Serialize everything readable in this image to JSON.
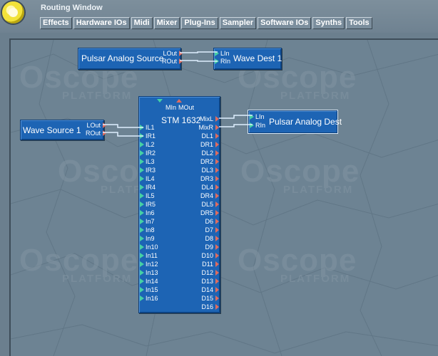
{
  "window": {
    "title": "Routing Window"
  },
  "menu": [
    "Effects",
    "Hardware IOs",
    "Midi",
    "Mixer",
    "Plug-Ins",
    "Sampler",
    "Software IOs",
    "Synths",
    "Tools"
  ],
  "watermark": {
    "logo": "Oscope",
    "sub": "PLATFORM"
  },
  "modules": {
    "pulsar_analog_source": {
      "name": "Pulsar Analog Source",
      "outputs": [
        "LOut",
        "ROut"
      ]
    },
    "wave_dest_1": {
      "name": "Wave Dest 1",
      "inputs": [
        "LIn",
        "RIn"
      ]
    },
    "wave_source_1": {
      "name": "Wave Source 1",
      "outputs": [
        "LOut",
        "ROut"
      ]
    },
    "pulsar_analog_dest": {
      "name": "Pulsar Analog Dest",
      "inputs": [
        "LIn",
        "RIn"
      ]
    },
    "stm_1632": {
      "name": "STM 1632",
      "midi": [
        "MIn",
        "MOut"
      ],
      "inputs": [
        "IL1",
        "IR1",
        "IL2",
        "IR2",
        "IL3",
        "IR3",
        "IL4",
        "IR4",
        "IL5",
        "IR5",
        "In6",
        "In7",
        "In8",
        "In9",
        "In10",
        "In11",
        "In12",
        "In13",
        "In14",
        "In15",
        "In16"
      ],
      "outputs": [
        "MixL",
        "MixR",
        "DL1",
        "DR1",
        "DL2",
        "DR2",
        "DL3",
        "DR3",
        "DL4",
        "DR4",
        "DL5",
        "DR5",
        "D6",
        "D7",
        "D8",
        "D9",
        "D10",
        "D11",
        "D12",
        "D13",
        "D14",
        "D15",
        "D16"
      ]
    }
  },
  "colors": {
    "input_port": "#45d0a4",
    "output_port": "#e06c5e",
    "module": "#1d64b4",
    "cable": "#e8f4ff"
  }
}
